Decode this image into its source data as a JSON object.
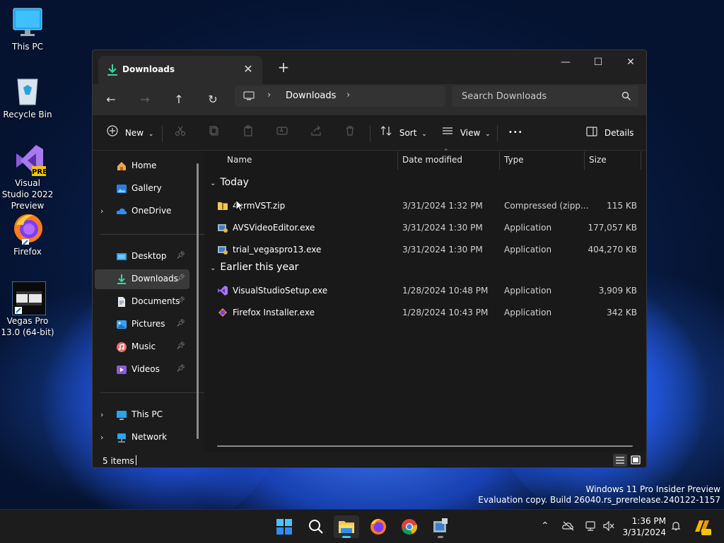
{
  "desktop": {
    "icons": [
      {
        "label": "This PC"
      },
      {
        "label": "Recycle Bin"
      },
      {
        "label": "Visual Studio 2022 Preview",
        "badge": "PRE"
      },
      {
        "label": "Firefox"
      },
      {
        "label": "Vegas Pro 13.0 (64-bit)"
      }
    ],
    "watermark_line1": "Windows 11 Pro Insider Preview",
    "watermark_line2": "Evaluation copy. Build 26040.rs_prerelease.240122-1157"
  },
  "window": {
    "tab_title": "Downloads",
    "tab_close": "✕",
    "new_tab": "+",
    "minimize": "—",
    "maximize": "☐",
    "close": "✕",
    "nav": {
      "back": "←",
      "forward": "→",
      "up": "↑",
      "refresh": "↻"
    },
    "address": {
      "crumb": "Downloads"
    },
    "search_placeholder": "Search Downloads",
    "commands": {
      "new_label": "New",
      "sort_label": "Sort",
      "view_label": "View",
      "more_label": "•••",
      "details_label": "Details"
    },
    "sidebar": {
      "items": [
        {
          "label": "Home"
        },
        {
          "label": "Gallery"
        },
        {
          "label": "OneDrive"
        },
        {
          "label": "Desktop"
        },
        {
          "label": "Downloads"
        },
        {
          "label": "Documents"
        },
        {
          "label": "Pictures"
        },
        {
          "label": "Music"
        },
        {
          "label": "Videos"
        },
        {
          "label": "This PC"
        },
        {
          "label": "Network"
        }
      ]
    },
    "columns": {
      "name": "Name",
      "date": "Date modified",
      "type": "Type",
      "size": "Size"
    },
    "groups": [
      {
        "title": "Today",
        "files": [
          {
            "name": "4ormVST.zip",
            "date": "3/31/2024 1:32 PM",
            "type": "Compressed (zipp...",
            "size": "115 KB"
          },
          {
            "name": "AVSVideoEditor.exe",
            "date": "3/31/2024 1:30 PM",
            "type": "Application",
            "size": "177,057 KB"
          },
          {
            "name": "trial_vegaspro13.exe",
            "date": "3/31/2024 1:30 PM",
            "type": "Application",
            "size": "404,270 KB"
          }
        ]
      },
      {
        "title": "Earlier this year",
        "files": [
          {
            "name": "VisualStudioSetup.exe",
            "date": "1/28/2024 10:48 PM",
            "type": "Application",
            "size": "3,909 KB"
          },
          {
            "name": "Firefox Installer.exe",
            "date": "1/28/2024 10:43 PM",
            "type": "Application",
            "size": "342 KB"
          }
        ]
      }
    ],
    "status": {
      "count": "5 items"
    }
  },
  "taskbar": {
    "time": "1:36 PM",
    "date": "3/31/2024",
    "tray_chevron": "⌃",
    "accent": "#4cc2ff"
  }
}
